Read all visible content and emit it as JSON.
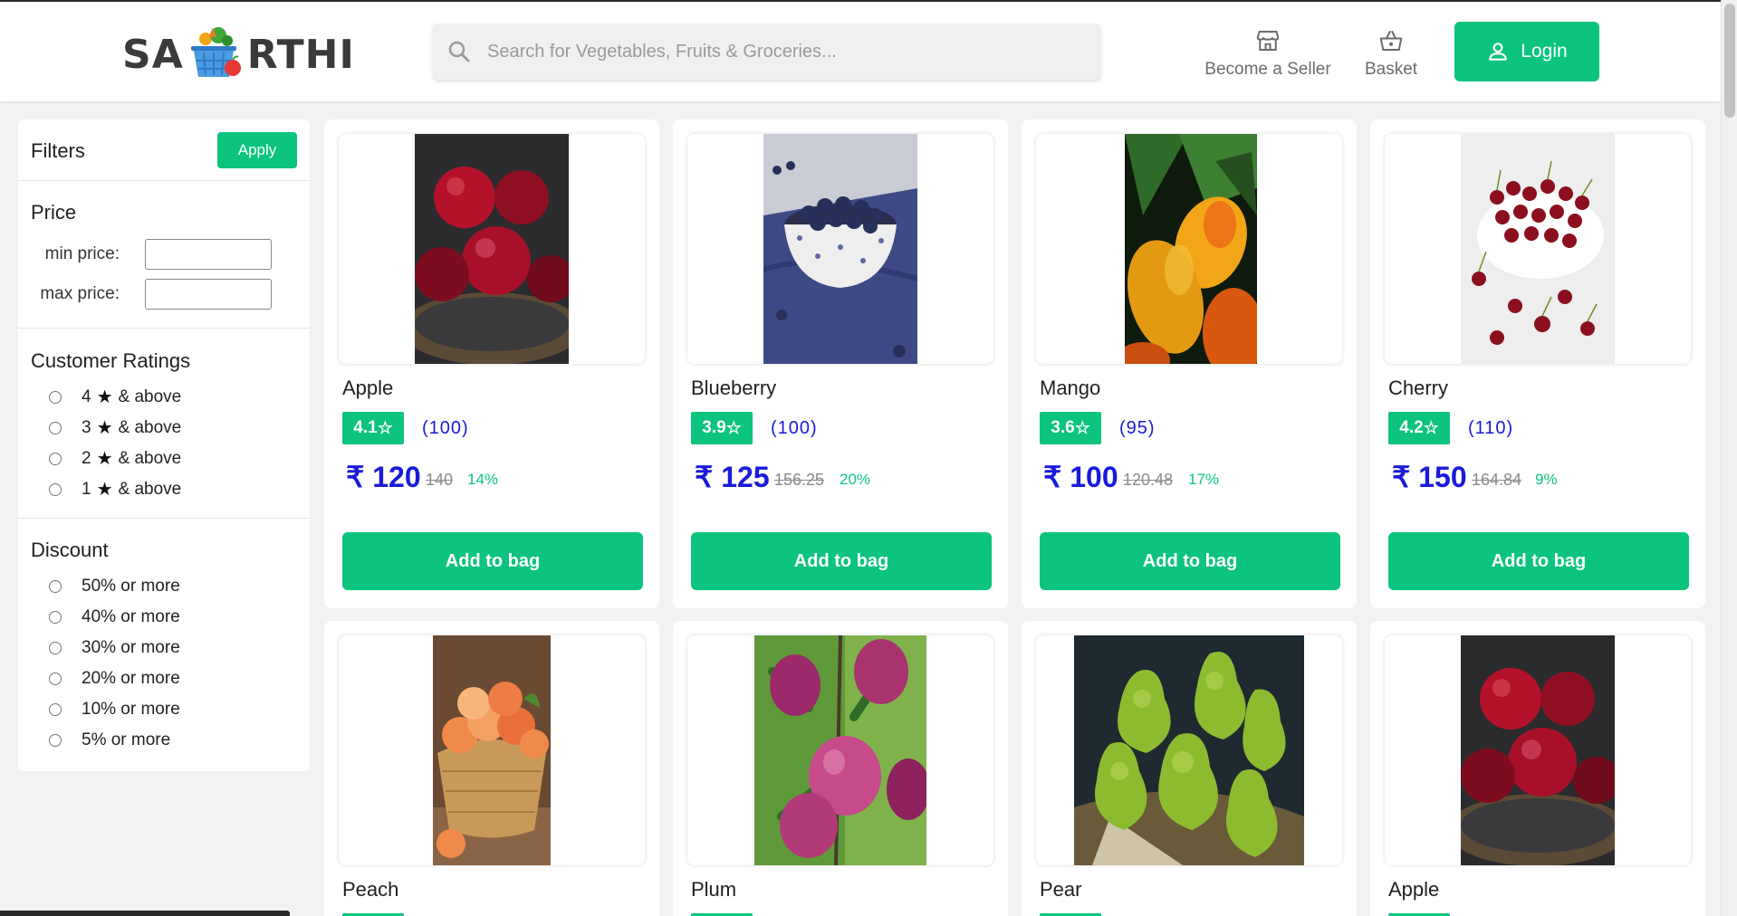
{
  "header": {
    "logo_left": "SA",
    "logo_right": "RTHI",
    "logo_icon": "vegetable-basket-icon",
    "search_placeholder": "Search for Vegetables, Fruits & Groceries...",
    "search_icon": "search-icon",
    "become_seller_label": "Become a Seller",
    "basket_label": "Basket",
    "login_label": "Login"
  },
  "sidebar": {
    "title": "Filters",
    "apply_label": "Apply",
    "price": {
      "title": "Price",
      "min_label": "min price:",
      "max_label": "max price:",
      "min_value": "",
      "max_value": ""
    },
    "ratings": {
      "title": "Customer Ratings",
      "options": [
        {
          "num": "4",
          "text": "& above"
        },
        {
          "num": "3",
          "text": "& above"
        },
        {
          "num": "2",
          "text": "& above"
        },
        {
          "num": "1",
          "text": "& above"
        }
      ]
    },
    "discount": {
      "title": "Discount",
      "options": [
        "50% or more",
        "40% or more",
        "30% or more",
        "20% or more",
        "10% or more",
        "5% or more"
      ]
    }
  },
  "products": [
    {
      "name": "Apple",
      "rating": "4.1",
      "reviews": "(100)",
      "price": "120",
      "mrp": "140",
      "discount": "14%",
      "add_label": "Add to bag"
    },
    {
      "name": "Blueberry",
      "rating": "3.9",
      "reviews": "(100)",
      "price": "125",
      "mrp": "156.25",
      "discount": "20%",
      "add_label": "Add to bag"
    },
    {
      "name": "Mango",
      "rating": "3.6",
      "reviews": "(95)",
      "price": "100",
      "mrp": "120.48",
      "discount": "17%",
      "add_label": "Add to bag"
    },
    {
      "name": "Cherry",
      "rating": "4.2",
      "reviews": "(110)",
      "price": "150",
      "mrp": "164.84",
      "discount": "9%",
      "add_label": "Add to bag"
    },
    {
      "name": "Peach"
    },
    {
      "name": "Plum"
    },
    {
      "name": "Pear"
    },
    {
      "name": "Apple"
    }
  ],
  "currency_symbol": "₹",
  "star_glyph": "☆",
  "colors": {
    "accent": "#0cc47e",
    "price_blue": "#1a1adb"
  }
}
